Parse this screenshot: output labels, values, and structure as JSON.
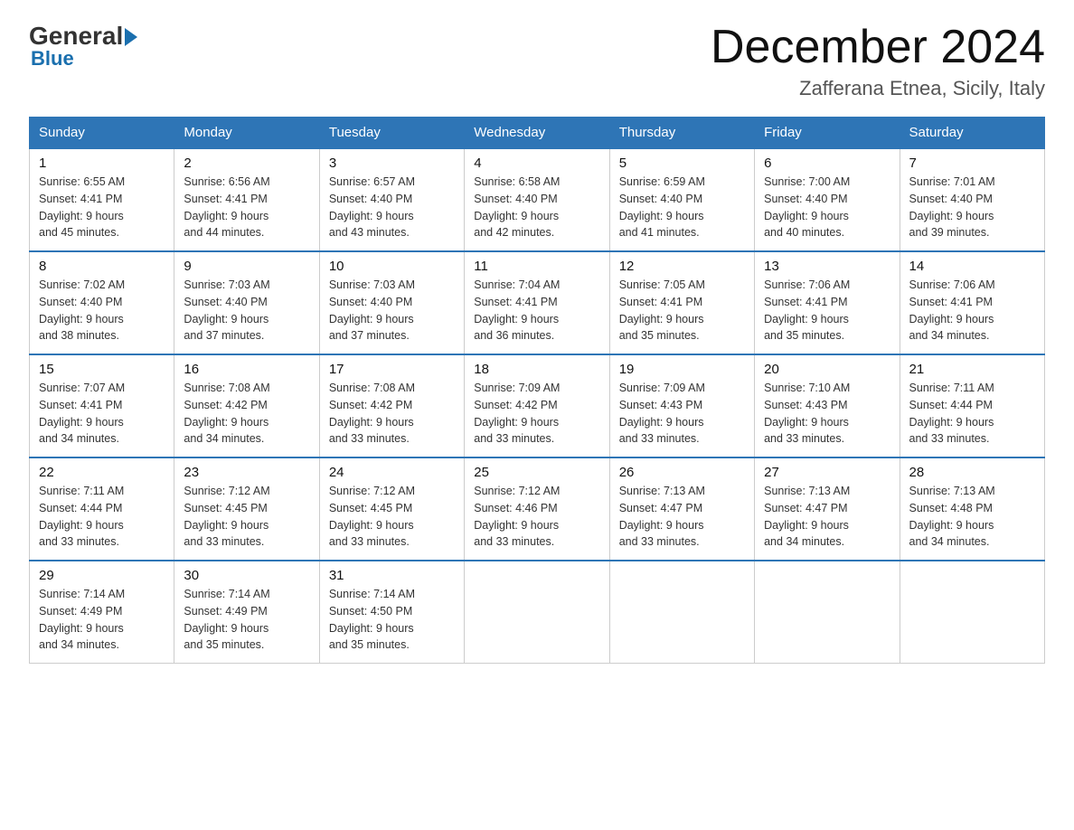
{
  "header": {
    "logo_general": "General",
    "logo_blue": "Blue",
    "month_title": "December 2024",
    "location": "Zafferana Etnea, Sicily, Italy"
  },
  "days_of_week": [
    "Sunday",
    "Monday",
    "Tuesday",
    "Wednesday",
    "Thursday",
    "Friday",
    "Saturday"
  ],
  "weeks": [
    [
      {
        "day": "1",
        "sunrise": "6:55 AM",
        "sunset": "4:41 PM",
        "daylight": "9 hours and 45 minutes."
      },
      {
        "day": "2",
        "sunrise": "6:56 AM",
        "sunset": "4:41 PM",
        "daylight": "9 hours and 44 minutes."
      },
      {
        "day": "3",
        "sunrise": "6:57 AM",
        "sunset": "4:40 PM",
        "daylight": "9 hours and 43 minutes."
      },
      {
        "day": "4",
        "sunrise": "6:58 AM",
        "sunset": "4:40 PM",
        "daylight": "9 hours and 42 minutes."
      },
      {
        "day": "5",
        "sunrise": "6:59 AM",
        "sunset": "4:40 PM",
        "daylight": "9 hours and 41 minutes."
      },
      {
        "day": "6",
        "sunrise": "7:00 AM",
        "sunset": "4:40 PM",
        "daylight": "9 hours and 40 minutes."
      },
      {
        "day": "7",
        "sunrise": "7:01 AM",
        "sunset": "4:40 PM",
        "daylight": "9 hours and 39 minutes."
      }
    ],
    [
      {
        "day": "8",
        "sunrise": "7:02 AM",
        "sunset": "4:40 PM",
        "daylight": "9 hours and 38 minutes."
      },
      {
        "day": "9",
        "sunrise": "7:03 AM",
        "sunset": "4:40 PM",
        "daylight": "9 hours and 37 minutes."
      },
      {
        "day": "10",
        "sunrise": "7:03 AM",
        "sunset": "4:40 PM",
        "daylight": "9 hours and 37 minutes."
      },
      {
        "day": "11",
        "sunrise": "7:04 AM",
        "sunset": "4:41 PM",
        "daylight": "9 hours and 36 minutes."
      },
      {
        "day": "12",
        "sunrise": "7:05 AM",
        "sunset": "4:41 PM",
        "daylight": "9 hours and 35 minutes."
      },
      {
        "day": "13",
        "sunrise": "7:06 AM",
        "sunset": "4:41 PM",
        "daylight": "9 hours and 35 minutes."
      },
      {
        "day": "14",
        "sunrise": "7:06 AM",
        "sunset": "4:41 PM",
        "daylight": "9 hours and 34 minutes."
      }
    ],
    [
      {
        "day": "15",
        "sunrise": "7:07 AM",
        "sunset": "4:41 PM",
        "daylight": "9 hours and 34 minutes."
      },
      {
        "day": "16",
        "sunrise": "7:08 AM",
        "sunset": "4:42 PM",
        "daylight": "9 hours and 34 minutes."
      },
      {
        "day": "17",
        "sunrise": "7:08 AM",
        "sunset": "4:42 PM",
        "daylight": "9 hours and 33 minutes."
      },
      {
        "day": "18",
        "sunrise": "7:09 AM",
        "sunset": "4:42 PM",
        "daylight": "9 hours and 33 minutes."
      },
      {
        "day": "19",
        "sunrise": "7:09 AM",
        "sunset": "4:43 PM",
        "daylight": "9 hours and 33 minutes."
      },
      {
        "day": "20",
        "sunrise": "7:10 AM",
        "sunset": "4:43 PM",
        "daylight": "9 hours and 33 minutes."
      },
      {
        "day": "21",
        "sunrise": "7:11 AM",
        "sunset": "4:44 PM",
        "daylight": "9 hours and 33 minutes."
      }
    ],
    [
      {
        "day": "22",
        "sunrise": "7:11 AM",
        "sunset": "4:44 PM",
        "daylight": "9 hours and 33 minutes."
      },
      {
        "day": "23",
        "sunrise": "7:12 AM",
        "sunset": "4:45 PM",
        "daylight": "9 hours and 33 minutes."
      },
      {
        "day": "24",
        "sunrise": "7:12 AM",
        "sunset": "4:45 PM",
        "daylight": "9 hours and 33 minutes."
      },
      {
        "day": "25",
        "sunrise": "7:12 AM",
        "sunset": "4:46 PM",
        "daylight": "9 hours and 33 minutes."
      },
      {
        "day": "26",
        "sunrise": "7:13 AM",
        "sunset": "4:47 PM",
        "daylight": "9 hours and 33 minutes."
      },
      {
        "day": "27",
        "sunrise": "7:13 AM",
        "sunset": "4:47 PM",
        "daylight": "9 hours and 34 minutes."
      },
      {
        "day": "28",
        "sunrise": "7:13 AM",
        "sunset": "4:48 PM",
        "daylight": "9 hours and 34 minutes."
      }
    ],
    [
      {
        "day": "29",
        "sunrise": "7:14 AM",
        "sunset": "4:49 PM",
        "daylight": "9 hours and 34 minutes."
      },
      {
        "day": "30",
        "sunrise": "7:14 AM",
        "sunset": "4:49 PM",
        "daylight": "9 hours and 35 minutes."
      },
      {
        "day": "31",
        "sunrise": "7:14 AM",
        "sunset": "4:50 PM",
        "daylight": "9 hours and 35 minutes."
      },
      null,
      null,
      null,
      null
    ]
  ],
  "labels": {
    "sunrise": "Sunrise:",
    "sunset": "Sunset:",
    "daylight": "Daylight:"
  }
}
